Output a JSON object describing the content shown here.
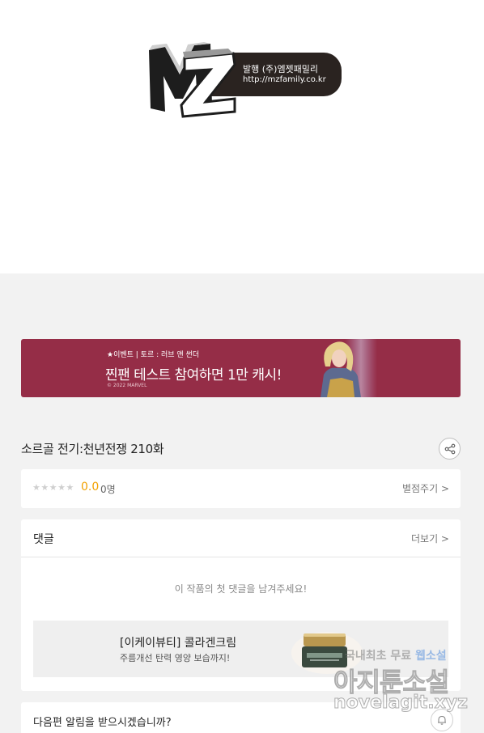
{
  "publisher": {
    "logo_letters": "MZ",
    "line1": "발행 (주)엠젯패밀리",
    "line2": "http://mzfamily.co.kr"
  },
  "banner": {
    "subtitle": "★이벤트 | 토르 : 러브 앤 썬더",
    "headline": "찐팬 테스트 참여하면 1만 캐시!",
    "copyright": "© 2022 MARVEL",
    "color": "#952d47"
  },
  "episode": {
    "title": "소르골 전기:천년전쟁 210화",
    "share_icon": "share-icon"
  },
  "rating": {
    "stars": "★★★★★",
    "score": "0.0",
    "count": "0명",
    "action": "별점주기 >"
  },
  "comments": {
    "heading": "댓글",
    "more": "더보기 >",
    "empty_message": "이 작품의 첫 댓글을 남겨주세요!"
  },
  "ad": {
    "title": "[이케이뷰티] 콜라겐크림",
    "subtitle": "주름개선 탄력 영양 보습까지!"
  },
  "notify": {
    "text": "다음편 알림을 받으시겠습니까?",
    "icon": "bell-icon"
  },
  "watermark": {
    "line1_prefix": "국내최초 무료 ",
    "line1_highlight": "웹소설",
    "line2": "아지툰소설",
    "line3": "novelagit.xyz"
  },
  "colors": {
    "accent_score": "#f2a100",
    "background": "#f2f2f2"
  }
}
